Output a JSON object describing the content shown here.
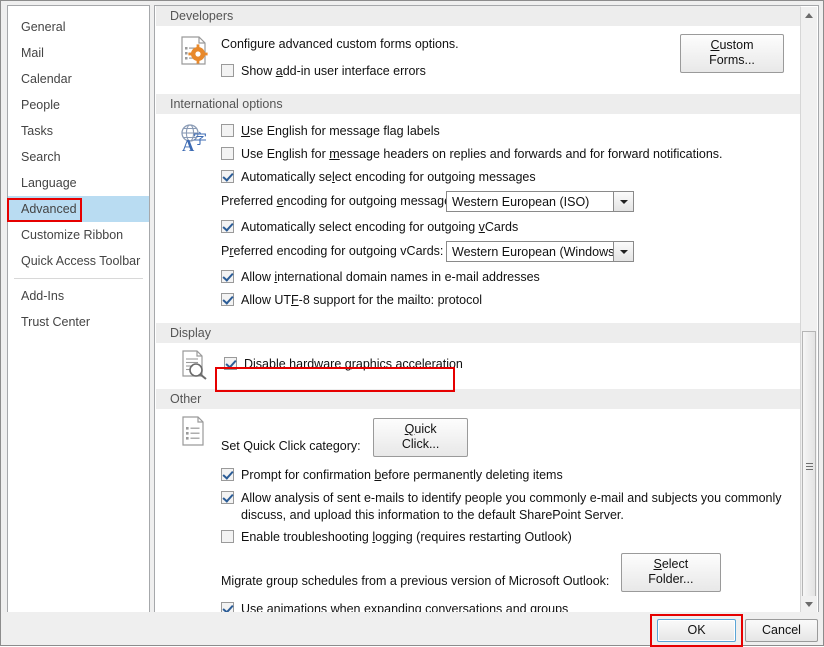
{
  "sidebar": {
    "items": [
      {
        "label": "General",
        "selected": false
      },
      {
        "label": "Mail",
        "selected": false
      },
      {
        "label": "Calendar",
        "selected": false
      },
      {
        "label": "People",
        "selected": false
      },
      {
        "label": "Tasks",
        "selected": false
      },
      {
        "label": "Search",
        "selected": false
      },
      {
        "label": "Language",
        "selected": false
      },
      {
        "label": "Advanced",
        "selected": true
      },
      {
        "label": "Customize Ribbon",
        "selected": false
      },
      {
        "label": "Quick Access Toolbar",
        "selected": false
      },
      {
        "label": "Add-Ins",
        "selected": false
      },
      {
        "label": "Trust Center",
        "selected": false
      }
    ]
  },
  "sections": {
    "developers": {
      "header": "Developers",
      "icon": "document-gear-icon",
      "description": "Configure advanced custom forms options.",
      "custom_forms_button": "Custom Forms...",
      "show_addin_errors": {
        "label_pre": "Show ",
        "label_accel": "a",
        "label_post": "dd-in user interface errors",
        "checked": false
      }
    },
    "international": {
      "header": "International options",
      "icon": "globe-language-icon",
      "flag_labels": {
        "label_pre": "",
        "label_accel": "U",
        "label_post": "se English for message flag labels",
        "checked": false
      },
      "message_headers": {
        "label_pre": "Use English for ",
        "label_accel": "m",
        "label_post": "essage headers on replies and forwards and for forward notifications.",
        "checked": false
      },
      "auto_encoding_messages": {
        "label_pre": "Automatically se",
        "label_accel": "l",
        "label_post": "ect encoding for outgoing messages",
        "checked": true
      },
      "preferred_encoding_messages_label_pre": "Preferred ",
      "preferred_encoding_messages_label_accel": "e",
      "preferred_encoding_messages_label_post": "ncoding for outgoing messages:",
      "preferred_encoding_messages_value": "Western European (ISO)",
      "auto_encoding_vcards": {
        "label_pre": "Automatically select encoding for outgoing ",
        "label_accel": "v",
        "label_post": "Cards",
        "checked": true
      },
      "preferred_encoding_vcards_label_pre": "P",
      "preferred_encoding_vcards_label_accel": "r",
      "preferred_encoding_vcards_label_post": "eferred encoding for outgoing vCards:",
      "preferred_encoding_vcards_value": "Western European (Windows)",
      "intl_domain_names": {
        "label_pre": "Allow ",
        "label_accel": "i",
        "label_post": "nternational domain names in e-mail addresses",
        "checked": true
      },
      "utf8_mailto": {
        "label_pre": "Allow UT",
        "label_accel": "F",
        "label_post": "-8 support for the mailto: protocol",
        "checked": true
      }
    },
    "display": {
      "header": "Display",
      "icon": "document-magnifier-icon",
      "disable_hw_accel": {
        "label_pre": "Disable hardware ",
        "label_accel": "g",
        "label_post": "raphics acceleration",
        "checked": true
      }
    },
    "other": {
      "header": "Other",
      "icon": "document-list-icon",
      "quick_click_label": "Set Quick Click category:",
      "quick_click_button_pre": "",
      "quick_click_button_accel": "Q",
      "quick_click_button_post": "uick Click...",
      "prompt_confirmation": {
        "label_pre": "Prompt for confirmation ",
        "label_accel": "b",
        "label_post": "efore permanently deleting items",
        "checked": true
      },
      "allow_analysis": {
        "label": "Allow analysis of sent e-mails to identify people you commonly e-mail and subjects you commonly discuss, and upload this information to the default SharePoint Server.",
        "checked": true
      },
      "troubleshooting_logging": {
        "label_pre": "Enable troubleshooting ",
        "label_accel": "l",
        "label_post": "ogging (requires restarting Outlook)",
        "checked": false
      },
      "migrate_label": "Migrate group schedules from a previous version of Microsoft Outlook:",
      "select_folder_button_pre": "",
      "select_folder_button_accel": "S",
      "select_folder_button_post": "elect Folder...",
      "use_animations": {
        "label_pre": "Use animations when expanding conversations and groups",
        "label_accel": "",
        "label_post": "",
        "checked": true
      }
    }
  },
  "footer": {
    "ok_label": "OK",
    "cancel_label": "Cancel"
  },
  "colors": {
    "selection": "#b9dcf2",
    "annotation": "#e60000",
    "section_header_bg": "#ededed",
    "focus_border": "#5ba5d6"
  }
}
